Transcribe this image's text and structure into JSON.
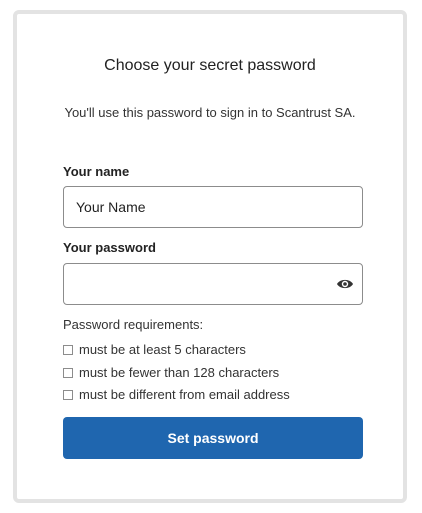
{
  "title": "Choose your secret password",
  "subtitle": "You'll use this password to sign in to Scantrust SA.",
  "name_field": {
    "label": "Your name",
    "value": "Your Name"
  },
  "password_field": {
    "label": "Your password",
    "value": "",
    "toggle_icon": "eye-icon"
  },
  "requirements": {
    "title": "Password requirements:",
    "items": [
      "must be at least 5 characters",
      "must be fewer than 128 characters",
      "must be different from email address"
    ]
  },
  "submit_label": "Set password",
  "colors": {
    "button": "#1f66af",
    "card_border": "#e3e3e3"
  }
}
